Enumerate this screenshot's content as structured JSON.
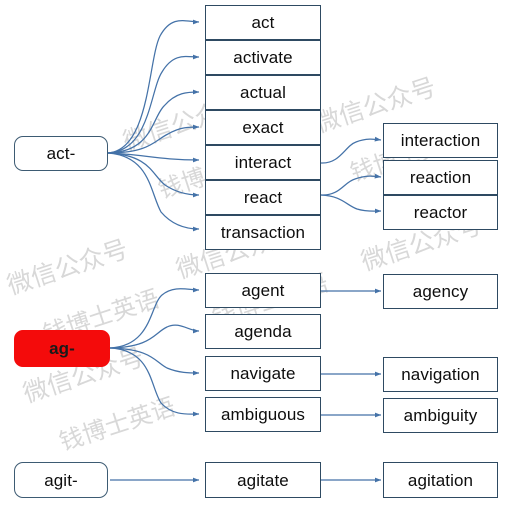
{
  "diagram": {
    "type": "word-root-mindmap",
    "title_text": "",
    "colors": {
      "arrow": "#4472a8",
      "box_border": "#2e4a62",
      "root_border": "#3d5b73",
      "highlight_fill": "#f40b0b",
      "highlight_text": "#1a1a1a",
      "text": "#0d0d0d",
      "background": "#ffffff",
      "watermark": "#d8d8d8"
    },
    "groups": [
      {
        "root": {
          "label": "act-",
          "highlighted": false
        },
        "level1": [
          {
            "label": "act"
          },
          {
            "label": "activate"
          },
          {
            "label": "actual"
          },
          {
            "label": "exact"
          },
          {
            "label": "interact"
          },
          {
            "label": "react"
          },
          {
            "label": "transaction"
          }
        ],
        "level2": [
          {
            "label": "interaction",
            "from": "interact"
          },
          {
            "label": "reaction",
            "from": "react"
          },
          {
            "label": "reactor",
            "from": "react"
          }
        ]
      },
      {
        "root": {
          "label": "ag-",
          "highlighted": true
        },
        "level1": [
          {
            "label": "agent"
          },
          {
            "label": "agenda"
          },
          {
            "label": "navigate"
          },
          {
            "label": "ambiguous"
          }
        ],
        "level2": [
          {
            "label": "agency",
            "from": "agent"
          },
          {
            "label": "navigation",
            "from": "navigate"
          },
          {
            "label": "ambiguity",
            "from": "ambiguous"
          }
        ]
      },
      {
        "root": {
          "label": "agit-",
          "highlighted": false
        },
        "level1": [
          {
            "label": "agitate"
          }
        ],
        "level2": [
          {
            "label": "agitation",
            "from": "agitate"
          }
        ]
      }
    ],
    "nodes": {
      "act_root": "act-",
      "act": "act",
      "activate": "activate",
      "actual": "actual",
      "exact": "exact",
      "interact": "interact",
      "react": "react",
      "transaction": "transaction",
      "interaction": "interaction",
      "reaction": "reaction",
      "reactor": "reactor",
      "ag_root": "ag-",
      "agent": "agent",
      "agenda": "agenda",
      "navigate": "navigate",
      "ambiguous": "ambiguous",
      "agency": "agency",
      "navigation": "navigation",
      "ambiguity": "ambiguity",
      "agit_root": "agit-",
      "agitate": "agitate",
      "agitation": "agitation"
    },
    "watermarks": [
      {
        "text": "微信公众号"
      },
      {
        "text": "钱博士英语"
      }
    ]
  }
}
